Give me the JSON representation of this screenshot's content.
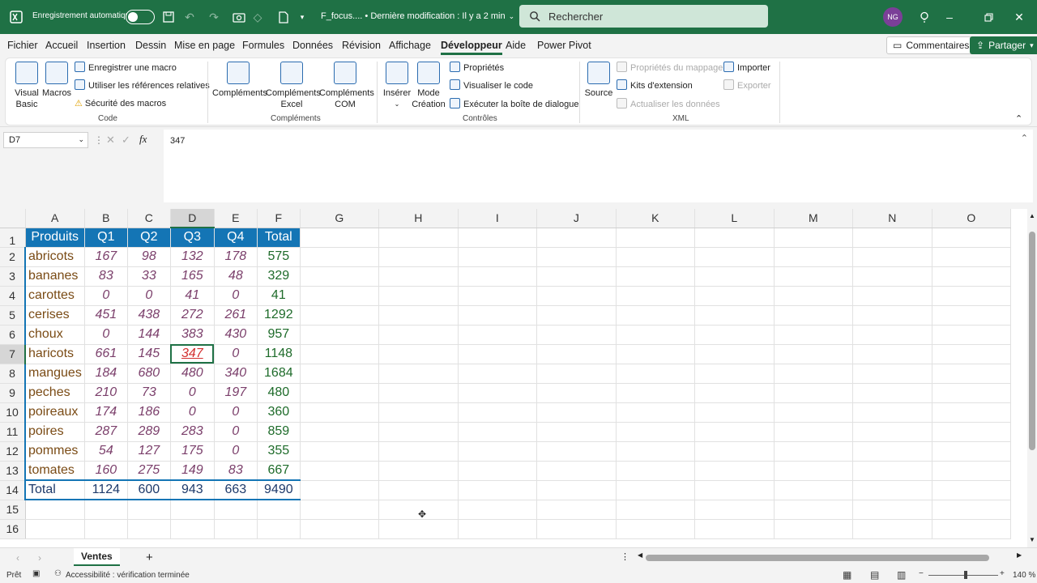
{
  "titlebar": {
    "autosave_label": "Enregistrement automatique",
    "doc_title": "F_focus.... • Dernière modification : Il y a 2 min",
    "search_placeholder": "Rechercher",
    "user_initials": "NG"
  },
  "menu": {
    "items": [
      "Fichier",
      "Accueil",
      "Insertion",
      "Dessin",
      "Mise en page",
      "Formules",
      "Données",
      "Révision",
      "Affichage",
      "Développeur",
      "Aide",
      "Power Pivot"
    ],
    "active": "Développeur",
    "comments_label": "Commentaires",
    "share_label": "Partager"
  },
  "ribbon": {
    "code": {
      "visual_basic": "Visual Basic",
      "macros": "Macros",
      "record_macro": "Enregistrer une macro",
      "relative_refs": "Utiliser les références relatives",
      "macro_security": "Sécurité des macros",
      "label": "Code"
    },
    "addins": {
      "complements": "Compléments",
      "excel_addins": "Compléments Excel",
      "com_addins": "Compléments COM",
      "label": "Compléments"
    },
    "controls": {
      "insert": "Insérer",
      "design_mode": "Mode Création",
      "properties": "Propriétés",
      "view_code": "Visualiser le code",
      "run_dialog": "Exécuter la boîte de dialogue",
      "label": "Contrôles"
    },
    "xml": {
      "source": "Source",
      "map_props": "Propriétés du mappage",
      "expansion_packs": "Kits d'extension",
      "refresh_data": "Actualiser les données",
      "import": "Importer",
      "export": "Exporter",
      "label": "XML"
    }
  },
  "formula_bar": {
    "name_box": "D7",
    "content": "347"
  },
  "columns": [
    "A",
    "B",
    "C",
    "D",
    "E",
    "F",
    "G",
    "H",
    "I",
    "J",
    "K",
    "L",
    "M",
    "N",
    "O"
  ],
  "selected_column": "D",
  "selected_row": "7",
  "table": {
    "headers": [
      "Produits",
      "Q1",
      "Q2",
      "Q3",
      "Q4",
      "Total"
    ],
    "rows": [
      {
        "n": "2",
        "name": "abricots",
        "q1": "167",
        "q2": "98",
        "q3": "132",
        "q4": "178",
        "total": "575"
      },
      {
        "n": "3",
        "name": "bananes",
        "q1": "83",
        "q2": "33",
        "q3": "165",
        "q4": "48",
        "total": "329"
      },
      {
        "n": "4",
        "name": "carottes",
        "q1": "0",
        "q2": "0",
        "q3": "41",
        "q4": "0",
        "total": "41"
      },
      {
        "n": "5",
        "name": "cerises",
        "q1": "451",
        "q2": "438",
        "q3": "272",
        "q4": "261",
        "total": "1292"
      },
      {
        "n": "6",
        "name": "choux",
        "q1": "0",
        "q2": "144",
        "q3": "383",
        "q4": "430",
        "total": "957"
      },
      {
        "n": "7",
        "name": "haricots",
        "q1": "661",
        "q2": "145",
        "q3": "347",
        "q4": "0",
        "total": "1148"
      },
      {
        "n": "8",
        "name": "mangues",
        "q1": "184",
        "q2": "680",
        "q3": "480",
        "q4": "340",
        "total": "1684"
      },
      {
        "n": "9",
        "name": "peches",
        "q1": "210",
        "q2": "73",
        "q3": "0",
        "q4": "197",
        "total": "480"
      },
      {
        "n": "10",
        "name": "poireaux",
        "q1": "174",
        "q2": "186",
        "q3": "0",
        "q4": "0",
        "total": "360"
      },
      {
        "n": "11",
        "name": "poires",
        "q1": "287",
        "q2": "289",
        "q3": "283",
        "q4": "0",
        "total": "859"
      },
      {
        "n": "12",
        "name": "pommes",
        "q1": "54",
        "q2": "127",
        "q3": "175",
        "q4": "0",
        "total": "355"
      },
      {
        "n": "13",
        "name": "tomates",
        "q1": "160",
        "q2": "275",
        "q3": "149",
        "q4": "83",
        "total": "667"
      }
    ],
    "total_row": {
      "n": "14",
      "name": "Total",
      "q1": "1124",
      "q2": "600",
      "q3": "943",
      "q4": "663",
      "total": "9490"
    },
    "extra_rows": [
      "15",
      "16"
    ]
  },
  "sheets": {
    "active": "Ventes",
    "add_label": "+"
  },
  "statusbar": {
    "ready": "Prêt",
    "accessibility": "Accessibilité : vérification terminée",
    "zoom": "140 %"
  }
}
